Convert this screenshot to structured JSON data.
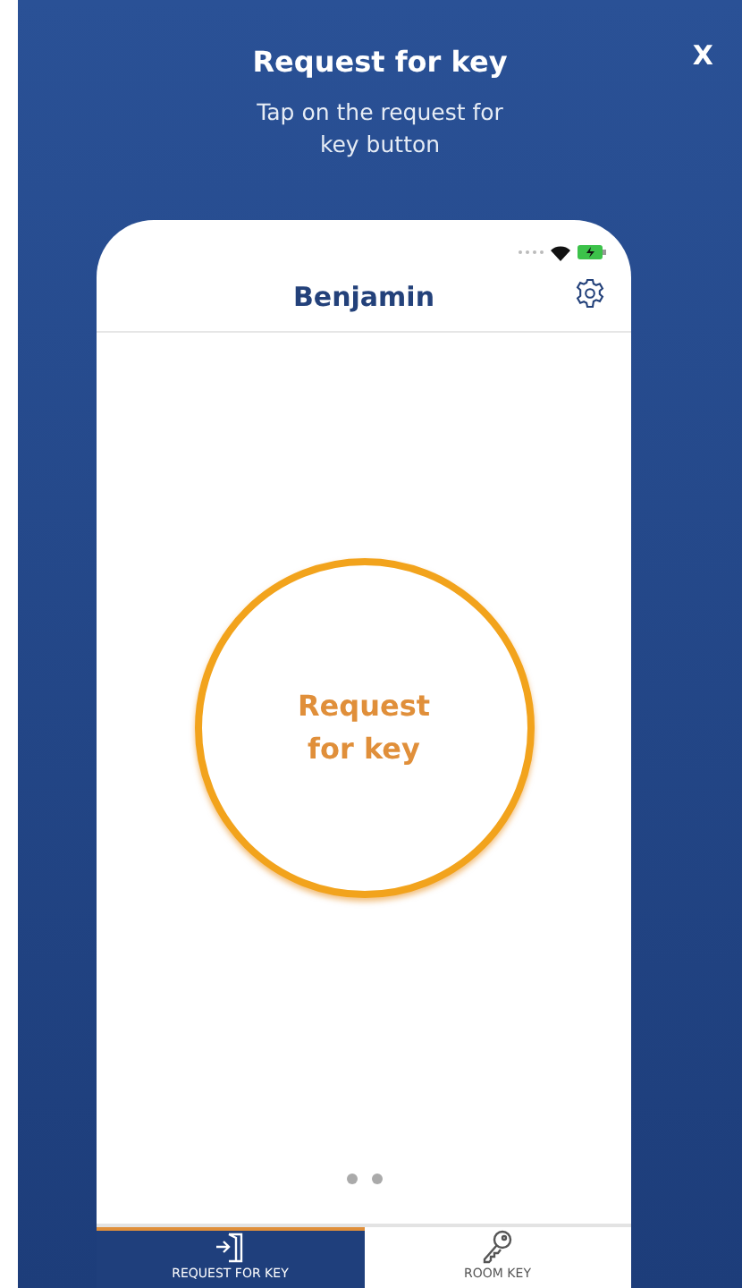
{
  "header": {
    "title": "Request for key",
    "subtitle": "Tap on the request for key button",
    "close": "X"
  },
  "phone": {
    "user_name": "Benjamin",
    "main_button": "Request for key",
    "page_dots": [
      {
        "selected": false
      },
      {
        "selected": false
      }
    ],
    "tabs": [
      {
        "label": "REQUEST FOR KEY",
        "kind": "door",
        "selected": true
      },
      {
        "label": "ROOM KEY",
        "kind": "key",
        "selected": false
      }
    ]
  }
}
